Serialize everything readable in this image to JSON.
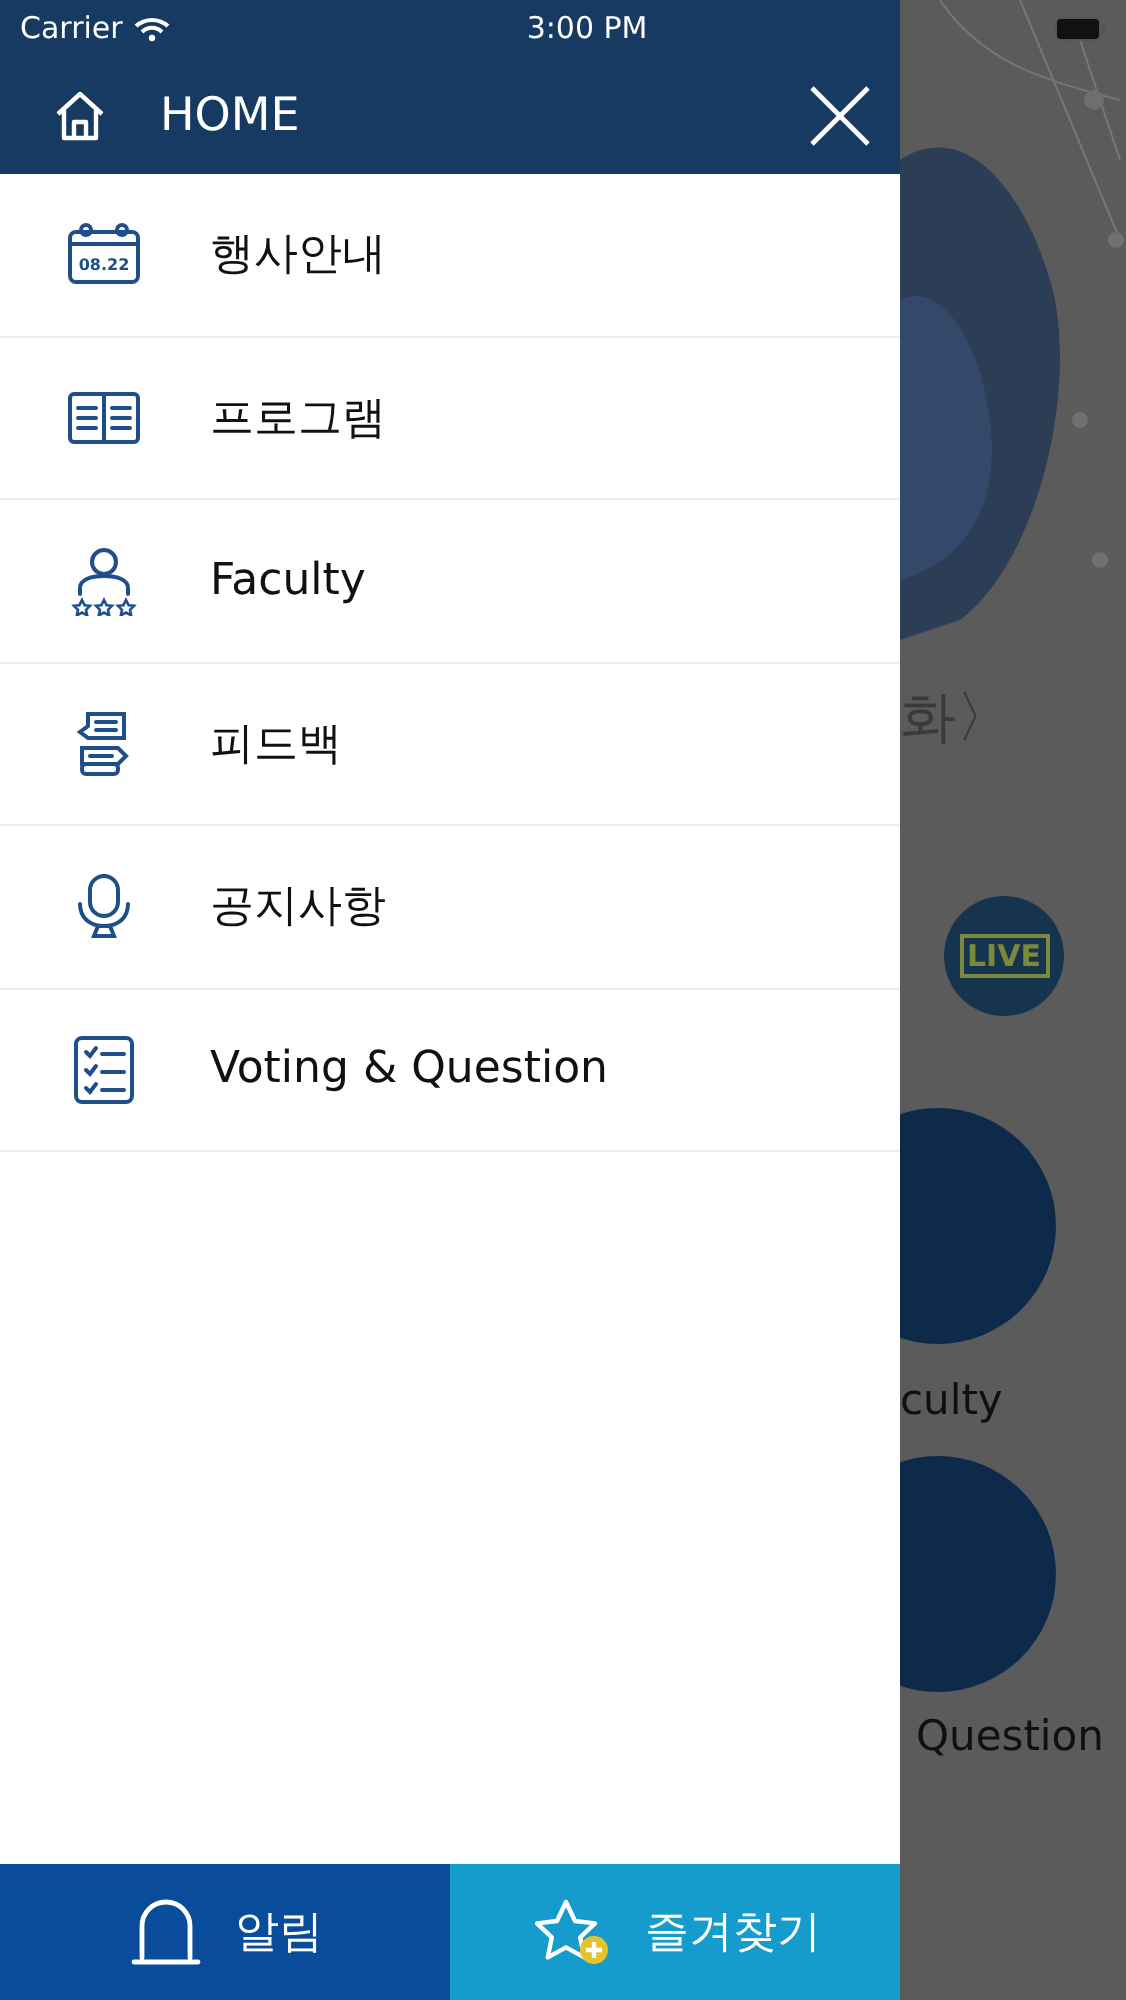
{
  "status_bar": {
    "carrier": "Carrier",
    "time": "3:00 PM"
  },
  "drawer": {
    "title": "HOME",
    "items": [
      {
        "kind": "calendar",
        "label": "행사안내",
        "icon_text": "08.22"
      },
      {
        "kind": "book",
        "label": "프로그램"
      },
      {
        "kind": "faculty",
        "label": "Faculty"
      },
      {
        "kind": "feedback",
        "label": "피드백"
      },
      {
        "kind": "microphone",
        "label": "공지사항"
      },
      {
        "kind": "checklist",
        "label": "Voting & Question"
      }
    ],
    "bottom_tabs": [
      {
        "kind": "bell",
        "label": "알림"
      },
      {
        "kind": "star",
        "label": "즐겨찾기"
      }
    ]
  },
  "background": {
    "subtitle": "화〉",
    "live_badge": "LIVE",
    "labels": [
      "culty",
      "Question"
    ]
  }
}
